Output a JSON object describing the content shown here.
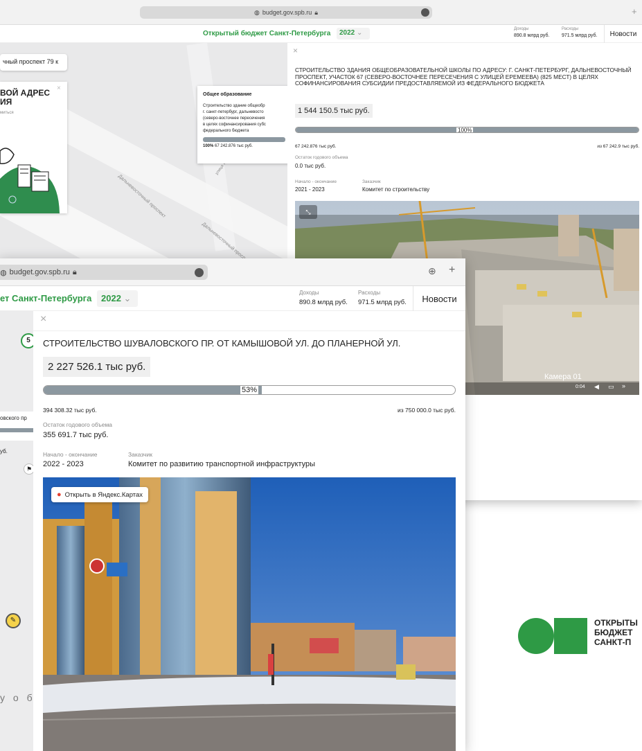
{
  "back": {
    "url": "budget.gov.spb.ru",
    "site_title": "Открытый бюджет Санкт-Петербурга",
    "year": "2022",
    "revenue_label": "Доходы",
    "revenue_value": "890.8 млрд руб.",
    "expense_label": "Расходы",
    "expense_value": "971.5 млрд руб.",
    "news_label": "Новости",
    "map": {
      "search_text": "чный проспект 79 к",
      "promo_title_1": "ВОЙ АДРЕС",
      "promo_title_2": "ИЯ",
      "promo_sub": "миться",
      "street_1": "Дальневосточный проспект",
      "street_2": "Дальневосточный проспект",
      "street_3": "улица Е",
      "popup": {
        "category": "Общее образование",
        "text_1": "Строительство здание общеобр",
        "text_2": "г. санкт-петербург, дальневосто",
        "text_3": "(северо-восточнее пересечения",
        "text_4": "в целях софинансирования субс",
        "text_5": "федерального бюджета",
        "percent": "100%",
        "amount": "67 242.876 тыс руб."
      }
    },
    "panel": {
      "title": "СТРОИТЕЛЬСТВО ЗДАНИЯ ОБЩЕОБРАЗОВАТЕЛЬНОЙ ШКОЛЫ ПО АДРЕСУ: Г. САНКТ-ПЕТЕРБУРГ, ДАЛЬНЕВОСТОЧНЫЙ ПРОСПЕКТ, УЧАСТОК 67 (СЕВЕРО-ВОСТОЧНЕЕ ПЕРЕСЕЧЕНИЯ С УЛИЦЕЙ ЕРЕМЕЕВА) (825 МЕСТ) В ЦЕЛЯХ СОФИНАНСИРОВАНИЯ СУБСИДИИ ПРЕДОСТАВЛЯЕМОЙ ИЗ ФЕДЕРАЛЬНОГО БЮДЖЕТА",
      "amount": "1 544 150.5 тыс руб.",
      "progress_percent": 100,
      "progress_text": "100%",
      "spent": "67 242.876 тыс руб.",
      "total": "из 67 242.9 тыс руб.",
      "remainder_label": "Остаток годового объема",
      "remainder_value": "0.0 тыс руб.",
      "period_label": "Начало - окончание",
      "period_value": "2021 - 2023",
      "customer_label": "Заказчик",
      "customer_value": "Комитет по строительству",
      "camera_label": "Камера 01",
      "video_time": "0:04"
    }
  },
  "front": {
    "url": "budget.gov.spb.ru",
    "site_title": "ет Санкт-Петербурга",
    "year": "2022",
    "revenue_label": "Доходы",
    "revenue_value": "890.8 млрд руб.",
    "expense_label": "Расходы",
    "expense_value": "971.5 млрд руб.",
    "news_label": "Новости",
    "map": {
      "cluster_count": "5",
      "street_fragment": "овского пр",
      "popup_fragment": "уб.",
      "bottom_text": "у о б"
    },
    "panel": {
      "title": "СТРОИТЕЛЬСТВО ШУВАЛОВСКОГО ПР. ОТ КАМЫШОВОЙ УЛ. ДО ПЛАНЕРНОЙ УЛ.",
      "amount": "2 227 526.1 тыс руб.",
      "progress_percent": 53,
      "progress_text": "53%",
      "spent": "394 308.32 тыс руб.",
      "total": "из 750 000.0 тыс руб.",
      "remainder_label": "Остаток годового объема",
      "remainder_value": "355 691.7 тыс руб.",
      "period_label": "Начало - окончание",
      "period_value": "2022 - 2023",
      "customer_label": "Заказчик",
      "customer_value": "Комитет по развитию транспортной инфраструктуры",
      "yandex_button": "Открыть в Яндекс.Картах"
    }
  },
  "logo": {
    "line_1": "ОТКРЫТЫ",
    "line_2": "БЮДЖЕТ",
    "line_3": "САНКТ-П"
  },
  "colors": {
    "brand_green": "#2e9a45",
    "progress_fill": "#8c98a0"
  }
}
